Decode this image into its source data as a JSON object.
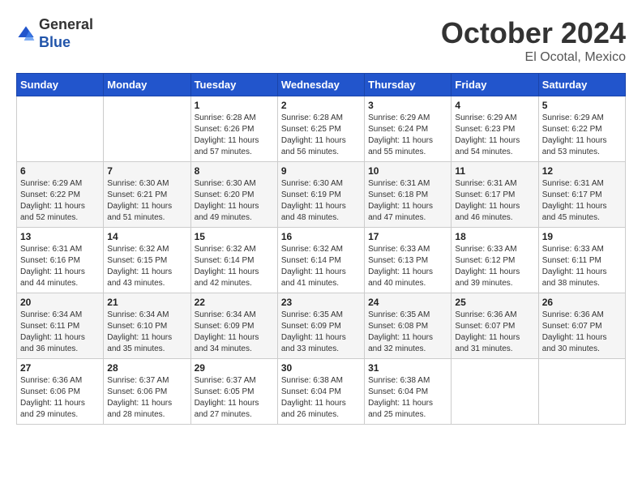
{
  "header": {
    "logo_general": "General",
    "logo_blue": "Blue",
    "month_title": "October 2024",
    "location": "El Ocotal, Mexico"
  },
  "calendar": {
    "days_of_week": [
      "Sunday",
      "Monday",
      "Tuesday",
      "Wednesday",
      "Thursday",
      "Friday",
      "Saturday"
    ],
    "weeks": [
      [
        {
          "day": "",
          "info": ""
        },
        {
          "day": "",
          "info": ""
        },
        {
          "day": "1",
          "info": "Sunrise: 6:28 AM\nSunset: 6:26 PM\nDaylight: 11 hours and 57 minutes."
        },
        {
          "day": "2",
          "info": "Sunrise: 6:28 AM\nSunset: 6:25 PM\nDaylight: 11 hours and 56 minutes."
        },
        {
          "day": "3",
          "info": "Sunrise: 6:29 AM\nSunset: 6:24 PM\nDaylight: 11 hours and 55 minutes."
        },
        {
          "day": "4",
          "info": "Sunrise: 6:29 AM\nSunset: 6:23 PM\nDaylight: 11 hours and 54 minutes."
        },
        {
          "day": "5",
          "info": "Sunrise: 6:29 AM\nSunset: 6:22 PM\nDaylight: 11 hours and 53 minutes."
        }
      ],
      [
        {
          "day": "6",
          "info": "Sunrise: 6:29 AM\nSunset: 6:22 PM\nDaylight: 11 hours and 52 minutes."
        },
        {
          "day": "7",
          "info": "Sunrise: 6:30 AM\nSunset: 6:21 PM\nDaylight: 11 hours and 51 minutes."
        },
        {
          "day": "8",
          "info": "Sunrise: 6:30 AM\nSunset: 6:20 PM\nDaylight: 11 hours and 49 minutes."
        },
        {
          "day": "9",
          "info": "Sunrise: 6:30 AM\nSunset: 6:19 PM\nDaylight: 11 hours and 48 minutes."
        },
        {
          "day": "10",
          "info": "Sunrise: 6:31 AM\nSunset: 6:18 PM\nDaylight: 11 hours and 47 minutes."
        },
        {
          "day": "11",
          "info": "Sunrise: 6:31 AM\nSunset: 6:17 PM\nDaylight: 11 hours and 46 minutes."
        },
        {
          "day": "12",
          "info": "Sunrise: 6:31 AM\nSunset: 6:17 PM\nDaylight: 11 hours and 45 minutes."
        }
      ],
      [
        {
          "day": "13",
          "info": "Sunrise: 6:31 AM\nSunset: 6:16 PM\nDaylight: 11 hours and 44 minutes."
        },
        {
          "day": "14",
          "info": "Sunrise: 6:32 AM\nSunset: 6:15 PM\nDaylight: 11 hours and 43 minutes."
        },
        {
          "day": "15",
          "info": "Sunrise: 6:32 AM\nSunset: 6:14 PM\nDaylight: 11 hours and 42 minutes."
        },
        {
          "day": "16",
          "info": "Sunrise: 6:32 AM\nSunset: 6:14 PM\nDaylight: 11 hours and 41 minutes."
        },
        {
          "day": "17",
          "info": "Sunrise: 6:33 AM\nSunset: 6:13 PM\nDaylight: 11 hours and 40 minutes."
        },
        {
          "day": "18",
          "info": "Sunrise: 6:33 AM\nSunset: 6:12 PM\nDaylight: 11 hours and 39 minutes."
        },
        {
          "day": "19",
          "info": "Sunrise: 6:33 AM\nSunset: 6:11 PM\nDaylight: 11 hours and 38 minutes."
        }
      ],
      [
        {
          "day": "20",
          "info": "Sunrise: 6:34 AM\nSunset: 6:11 PM\nDaylight: 11 hours and 36 minutes."
        },
        {
          "day": "21",
          "info": "Sunrise: 6:34 AM\nSunset: 6:10 PM\nDaylight: 11 hours and 35 minutes."
        },
        {
          "day": "22",
          "info": "Sunrise: 6:34 AM\nSunset: 6:09 PM\nDaylight: 11 hours and 34 minutes."
        },
        {
          "day": "23",
          "info": "Sunrise: 6:35 AM\nSunset: 6:09 PM\nDaylight: 11 hours and 33 minutes."
        },
        {
          "day": "24",
          "info": "Sunrise: 6:35 AM\nSunset: 6:08 PM\nDaylight: 11 hours and 32 minutes."
        },
        {
          "day": "25",
          "info": "Sunrise: 6:36 AM\nSunset: 6:07 PM\nDaylight: 11 hours and 31 minutes."
        },
        {
          "day": "26",
          "info": "Sunrise: 6:36 AM\nSunset: 6:07 PM\nDaylight: 11 hours and 30 minutes."
        }
      ],
      [
        {
          "day": "27",
          "info": "Sunrise: 6:36 AM\nSunset: 6:06 PM\nDaylight: 11 hours and 29 minutes."
        },
        {
          "day": "28",
          "info": "Sunrise: 6:37 AM\nSunset: 6:06 PM\nDaylight: 11 hours and 28 minutes."
        },
        {
          "day": "29",
          "info": "Sunrise: 6:37 AM\nSunset: 6:05 PM\nDaylight: 11 hours and 27 minutes."
        },
        {
          "day": "30",
          "info": "Sunrise: 6:38 AM\nSunset: 6:04 PM\nDaylight: 11 hours and 26 minutes."
        },
        {
          "day": "31",
          "info": "Sunrise: 6:38 AM\nSunset: 6:04 PM\nDaylight: 11 hours and 25 minutes."
        },
        {
          "day": "",
          "info": ""
        },
        {
          "day": "",
          "info": ""
        }
      ]
    ]
  }
}
